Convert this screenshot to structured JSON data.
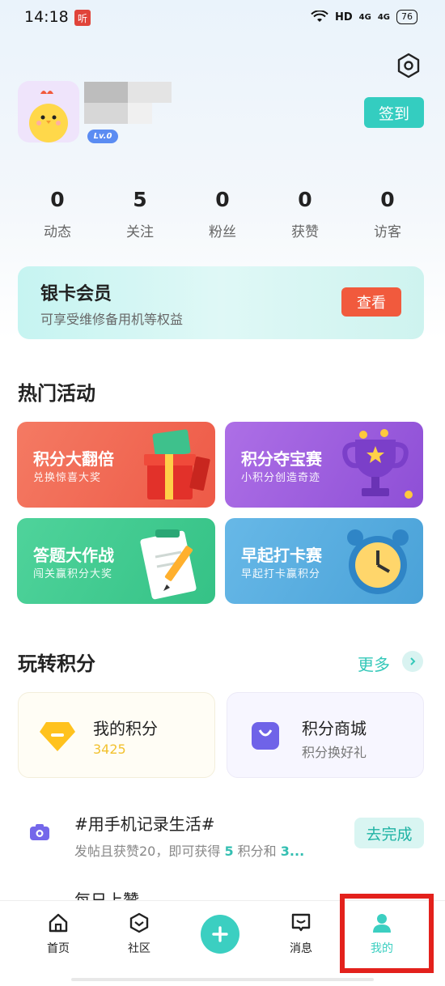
{
  "status": {
    "time": "14:18",
    "listen_badge": "听",
    "network": "HD",
    "sig1": "4G",
    "sig2": "4G",
    "battery": "76"
  },
  "profile": {
    "level": "Lv.0",
    "checkin_label": "签到"
  },
  "stats": [
    {
      "value": "0",
      "label": "动态"
    },
    {
      "value": "5",
      "label": "关注"
    },
    {
      "value": "0",
      "label": "粉丝"
    },
    {
      "value": "0",
      "label": "获赞"
    },
    {
      "value": "0",
      "label": "访客"
    }
  ],
  "vip": {
    "title": "银卡会员",
    "subtitle": "可享受维修备用机等权益",
    "button": "查看"
  },
  "hot": {
    "title": "热门活动",
    "items": [
      {
        "title": "积分大翻倍",
        "subtitle": "兑换惊喜大奖",
        "color": "#f06a55"
      },
      {
        "title": "积分夺宝赛",
        "subtitle": "小积分创造奇迹",
        "color": "#9a5fdb"
      },
      {
        "title": "答题大作战",
        "subtitle": "闯关赢积分大奖",
        "color": "#3ecb8f"
      },
      {
        "title": "早起打卡赛",
        "subtitle": "早起打卡赢积分",
        "color": "#4ea7dc"
      }
    ]
  },
  "points": {
    "title": "玩转积分",
    "more": "更多",
    "my_points": {
      "title": "我的积分",
      "value": "3425"
    },
    "mall": {
      "title": "积分商城",
      "subtitle": "积分换好礼"
    }
  },
  "tasks": [
    {
      "title": "#用手机记录生活#",
      "desc_a": "发帖且获赞20，即可获得 ",
      "desc_hl1": "5",
      "desc_b": " 积分和 ",
      "desc_hl2": "3...",
      "button": "去完成"
    },
    {
      "title": "每日上赞"
    }
  ],
  "tabbar": {
    "home": "首页",
    "community": "社区",
    "messages": "消息",
    "mine": "我的"
  },
  "colors": {
    "accent": "#34cdc0",
    "highlight": "#e3211c"
  }
}
